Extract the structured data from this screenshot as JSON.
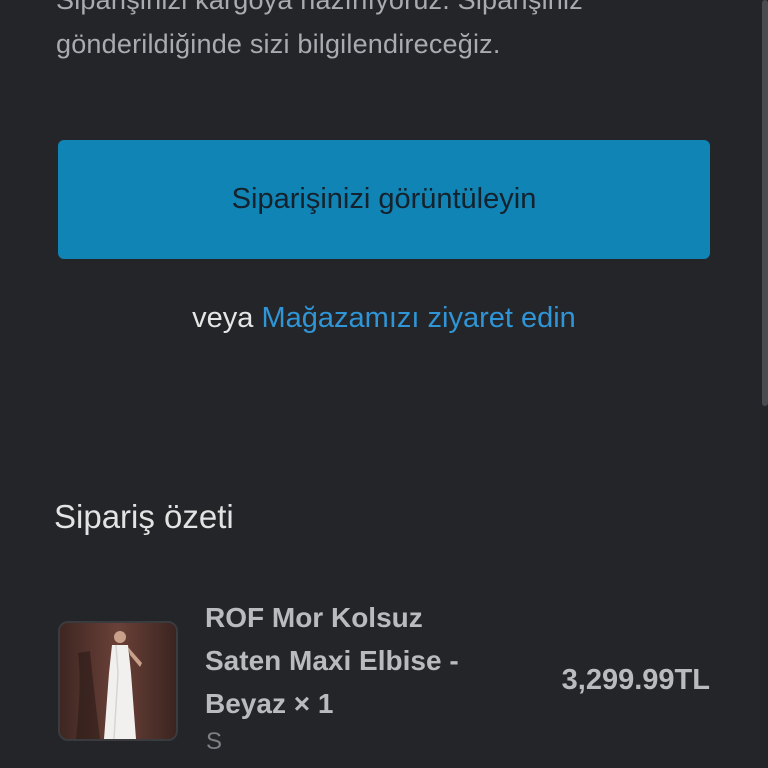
{
  "intro": {
    "text": "Siparişinizi kargoya hazırlıyoruz. Siparişiniz gönderildiğinde sizi bilgilendireceğiz."
  },
  "actions": {
    "view_order_label": "Siparişinizi görüntüleyin",
    "or_text": "veya",
    "visit_store_label": "Mağazamızı ziyaret edin"
  },
  "summary": {
    "title": "Sipariş özeti",
    "items": [
      {
        "name": "ROF Mor Kolsuz Saten Maxi Elbise - Beyaz × 1",
        "variant": "S",
        "price": "3,299.99TL"
      }
    ]
  },
  "colors": {
    "background": "#242528",
    "accent_button": "#1184b6",
    "link": "#2f95d6"
  }
}
